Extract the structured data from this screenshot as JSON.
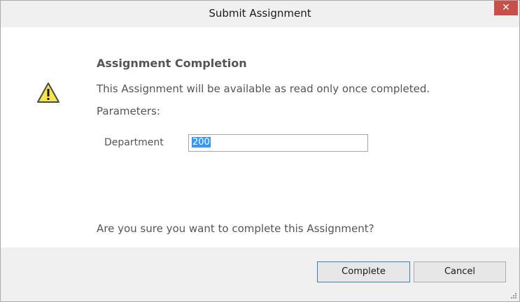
{
  "dialog": {
    "title": "Submit Assignment",
    "close_label": "✕"
  },
  "content": {
    "heading": "Assignment Completion",
    "message": "This Assignment will be available as read only once completed.",
    "params_label": "Parameters:",
    "department": {
      "label": "Department",
      "value": "200"
    },
    "confirm": "Are you sure you want to complete this Assignment?"
  },
  "footer": {
    "complete_label": "Complete",
    "cancel_label": "Cancel"
  },
  "icons": {
    "warning": "warning-icon",
    "close": "close-icon",
    "resize": "resize-grip-icon"
  },
  "colors": {
    "close_bg": "#c7504b",
    "selection": "#3399ff",
    "warning_fill": "#f5e64a"
  }
}
